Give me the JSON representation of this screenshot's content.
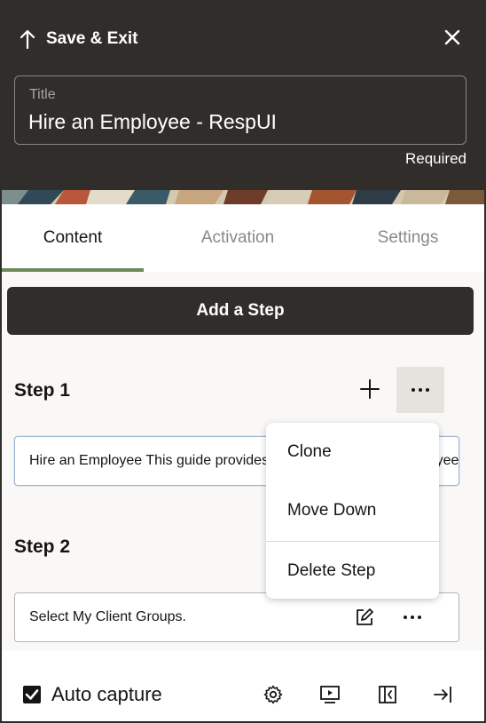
{
  "header": {
    "save_exit_label": "Save & Exit",
    "title_label": "Title",
    "title_value": "Hire an Employee - RespUI",
    "required_label": "Required"
  },
  "tabs": [
    {
      "label": "Content",
      "active": true
    },
    {
      "label": "Activation",
      "active": false
    },
    {
      "label": "Settings",
      "active": false
    }
  ],
  "add_step_label": "Add a Step",
  "steps": [
    {
      "title": "Step 1",
      "text": "Hire an Employee This guide provides the steps to hire an employee."
    },
    {
      "title": "Step 2",
      "text": "Select My Client Groups."
    }
  ],
  "menu": {
    "items": [
      "Clone",
      "Move Down",
      "Delete Step"
    ]
  },
  "footer": {
    "auto_capture_label": "Auto capture",
    "auto_capture_checked": true
  },
  "colors": {
    "header_bg": "#312d2a",
    "active_tab_underline": "#6c8a5a",
    "button_bg": "#312d2a"
  },
  "icons": [
    "arrow-up-icon",
    "close-icon",
    "plus-icon",
    "more-icon",
    "edit-icon",
    "gear-icon",
    "preview-icon",
    "collapse-panel-icon",
    "exit-icon",
    "checkmark-icon"
  ]
}
